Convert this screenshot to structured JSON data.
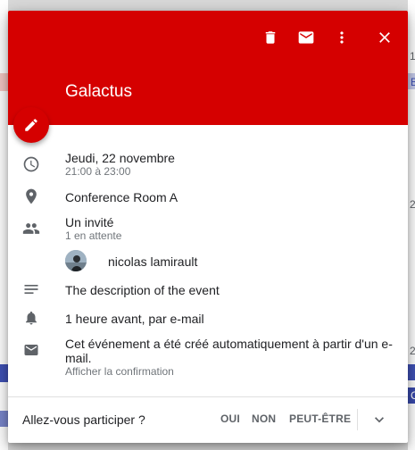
{
  "header": {
    "title": "Galactus",
    "color": "#d50000",
    "actions": {
      "delete_icon": "trash-icon",
      "email_icon": "email-icon",
      "more_icon": "more-vert-icon",
      "close_icon": "close-icon"
    }
  },
  "edit_button": {
    "icon": "pencil-icon"
  },
  "event": {
    "date": "Jeudi, 22 novembre",
    "time": "21:00 à 23:00",
    "location": "Conference Room A",
    "guests_title": "Un invité",
    "guests_status": "1 en attente",
    "guest_name": "nicolas lamirault",
    "description": "The description of the event",
    "reminder": "1 heure avant, par e-mail",
    "email_note": "Cet événement a été créé automatiquement à partir d'un e-mail.",
    "email_link": "Afficher la confirmation"
  },
  "footer": {
    "question": "Allez-vous participer ?",
    "yes": "OUI",
    "no": "NON",
    "maybe": "PEUT-ÊTRE"
  },
  "background": {
    "cal_1": "1",
    "cal_2": "2",
    "cal_3": "2",
    "cal_b": "B",
    "cal_c": "C"
  }
}
